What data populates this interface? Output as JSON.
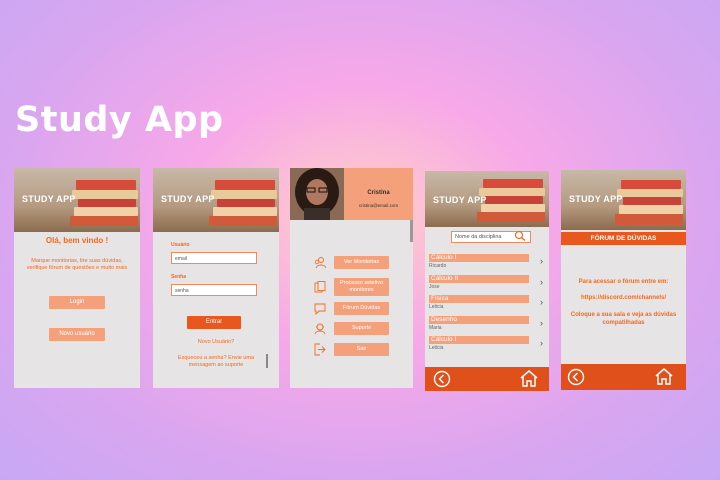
{
  "title": "Study App",
  "screen1": {
    "app_name": "STUDY APP",
    "welcome": "Olá, bem vindo !",
    "description": "Marque monitorias, tire suas dúvidas, verifique fórum de questões e muito mais",
    "login_label": "Login",
    "new_user_label": "Novo usuário"
  },
  "screen2": {
    "app_name": "STUDY APP",
    "user_label": "Usuário",
    "user_placeholder": "email",
    "password_label": "Senha",
    "password_placeholder": "senha",
    "enter_label": "Entrar",
    "new_user_link": "Novo Usuário?",
    "forgot_text": "Esqueceu a senha? Envie uma mensagem ao suporte"
  },
  "screen3": {
    "user_name": "Cristina",
    "user_email": "cristina@email.com",
    "menu": [
      {
        "label": "Ver Monitorias",
        "icon": "people-icon"
      },
      {
        "label": "Processo seletivo monitores",
        "icon": "documents-icon"
      },
      {
        "label": "Fórum Dúvidas",
        "icon": "chat-icon"
      },
      {
        "label": "Suporte",
        "icon": "support-icon"
      },
      {
        "label": "Sair",
        "icon": "exit-icon"
      }
    ]
  },
  "screen4": {
    "app_name": "STUDY APP",
    "search_placeholder": "Nome da disciplina",
    "items": [
      {
        "subject": "Cálculo I",
        "teacher": "Ricardo"
      },
      {
        "subject": "Cálculo II",
        "teacher": "Jose"
      },
      {
        "subject": "Física",
        "teacher": "Leticia"
      },
      {
        "subject": "Desenho",
        "teacher": "Maria"
      },
      {
        "subject": "Cálculo I",
        "teacher": "Leticia"
      }
    ]
  },
  "screen5": {
    "app_name": "STUDY APP",
    "header": "FÓRUM DE DÚVIDAS",
    "line1": "Para acessar o fórum entre em:",
    "link": "https://discord.com/channels/",
    "line2": "Coloque a sua sala e veja as dúvidas compatilhadas"
  },
  "colors": {
    "accent": "#f26a1f",
    "button": "#f4a07a",
    "footer": "#e0501a",
    "screen_bg": "#e6e4e4"
  }
}
